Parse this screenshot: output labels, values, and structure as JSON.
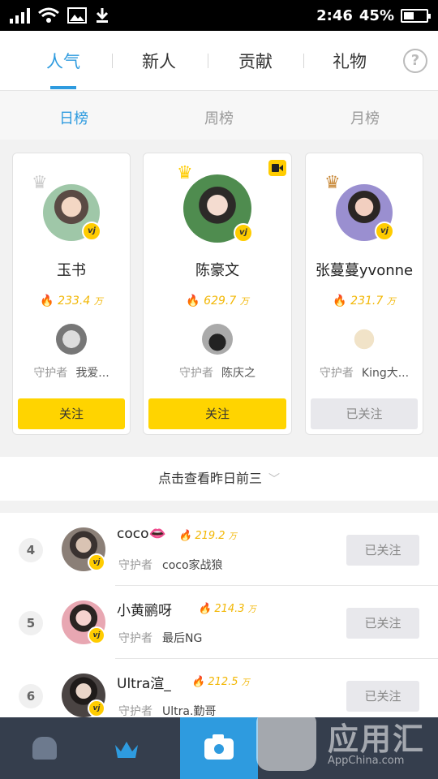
{
  "status_bar": {
    "time": "2:46",
    "battery": "45%",
    "battery_level": 0.45
  },
  "main_tabs": [
    {
      "label": "人气",
      "active": true
    },
    {
      "label": "新人",
      "active": false
    },
    {
      "label": "贡献",
      "active": false
    },
    {
      "label": "礼物",
      "active": false
    }
  ],
  "help_icon": "?",
  "sub_tabs": [
    {
      "label": "日榜",
      "active": true
    },
    {
      "label": "周榜",
      "active": false
    },
    {
      "label": "月榜",
      "active": false
    }
  ],
  "top3": [
    {
      "rank": 2,
      "name": "玉书",
      "popularity": "233.4",
      "unit": "万",
      "guard_label": "守护者",
      "guard_name": "我爱...",
      "follow_label": "关注",
      "followed": false,
      "crown": "silver"
    },
    {
      "rank": 1,
      "name": "陈豪文",
      "popularity": "629.7",
      "unit": "万",
      "guard_label": "守护者",
      "guard_name": "陈庆之",
      "follow_label": "关注",
      "followed": false,
      "crown": "gold",
      "live": true
    },
    {
      "rank": 3,
      "name": "张蔓蔓yvonne",
      "popularity": "231.7",
      "unit": "万",
      "guard_label": "守护者",
      "guard_name": "King大...",
      "follow_label": "已关注",
      "followed": true,
      "crown": "bronze"
    }
  ],
  "yesterday_link": "点击查看昨日前三",
  "list": [
    {
      "rank": "4",
      "name": "coco👄",
      "popularity": "219.2",
      "unit": "万",
      "guard_label": "守护者",
      "guard_name": "coco家战狼",
      "follow_label": "已关注"
    },
    {
      "rank": "5",
      "name": "小黄鹂呀",
      "popularity": "214.3",
      "unit": "万",
      "guard_label": "守护者",
      "guard_name": "最后NG",
      "follow_label": "已关注"
    },
    {
      "rank": "6",
      "name": "Ultra渲_",
      "popularity": "212.5",
      "unit": "万",
      "guard_label": "守护者",
      "guard_name": "Ultra.勤哥",
      "follow_label": "已关注"
    }
  ],
  "badge_text": "vj",
  "watermark": {
    "text": "应用汇",
    "url": "AppChina.com"
  }
}
